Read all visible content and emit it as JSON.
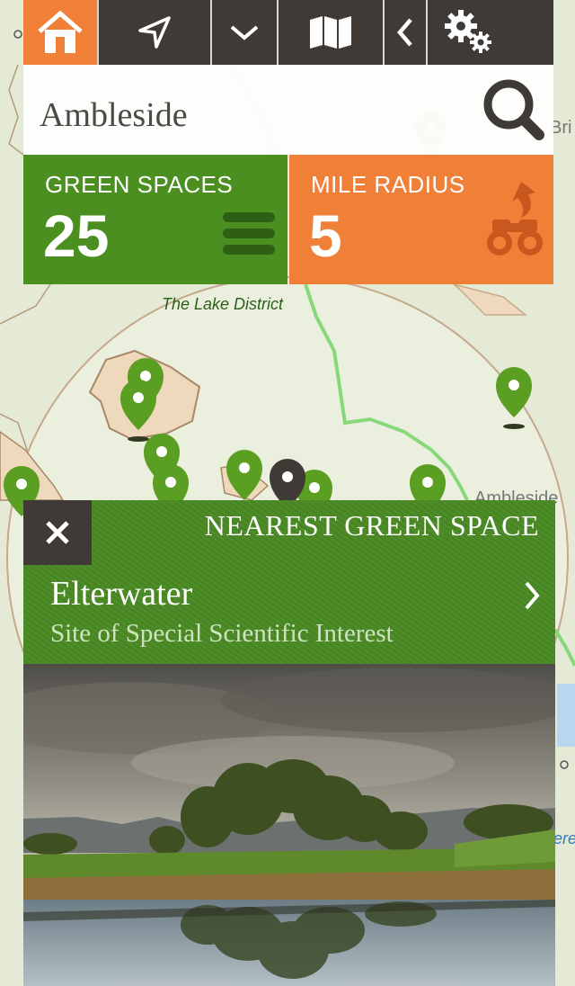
{
  "toolbar": {
    "buttons": [
      {
        "icon": "home-icon"
      },
      {
        "icon": "location-arrow-icon"
      },
      {
        "icon": "chevron-down-icon"
      },
      {
        "icon": "map-icon"
      },
      {
        "icon": "back-icon"
      },
      {
        "icon": "settings-gears-icon"
      }
    ]
  },
  "search": {
    "value": "Ambleside"
  },
  "stats": {
    "green_spaces": {
      "label": "GREEN SPACES",
      "value": "25"
    },
    "mile_radius": {
      "label": "MILE RADIUS",
      "value": "5"
    }
  },
  "map": {
    "region_label": "The Lake District",
    "town_label": "Ambleside",
    "edge_label_top": "Bri",
    "edge_label_bottom": "ere"
  },
  "nearest": {
    "heading": "NEAREST GREEN SPACE",
    "name": "Elterwater",
    "type": "Site of Special Scientific Interest"
  },
  "colors": {
    "accent_orange": "#f07f37",
    "accent_green": "#4a8f1f",
    "toolbar_dark": "#3f3a36",
    "pin_green": "#5a9e22"
  }
}
